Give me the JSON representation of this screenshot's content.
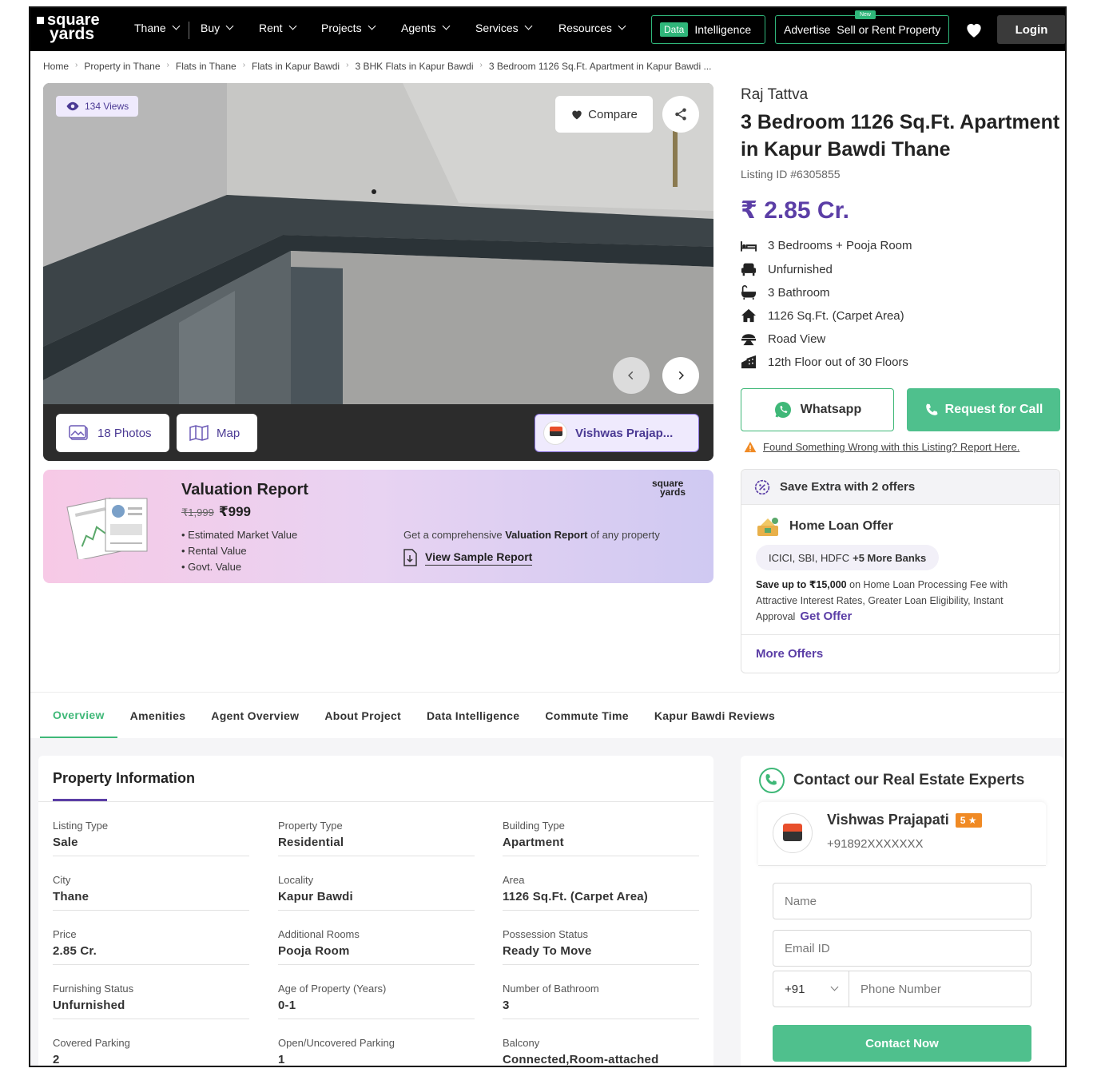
{
  "nav": {
    "logo_line1": "square",
    "logo_line2": "yards",
    "items": [
      "Thane",
      "Buy",
      "Rent",
      "Projects",
      "Agents",
      "Services",
      "Resources"
    ],
    "data_badge": "Data",
    "intelligence": "Intelligence",
    "advertise": "Advertise",
    "sell_rent": "Sell or Rent Property",
    "new_badge": "New",
    "login": "Login"
  },
  "breadcrumbs": [
    "Home",
    "Property in Thane",
    "Flats in Thane",
    "Flats in Kapur Bawdi",
    "3 BHK Flats in Kapur Bawdi",
    "3 Bedroom 1126 Sq.Ft. Apartment in Kapur Bawdi ..."
  ],
  "gallery": {
    "views": "134 Views",
    "compare": "Compare",
    "photos": "18 Photos",
    "map": "Map",
    "agent_chip": "Vishwas Prajap..."
  },
  "valuation": {
    "title": "Valuation Report",
    "old_price": "₹1,999",
    "new_price": "₹999",
    "points": [
      "Estimated Market Value",
      "Rental Value",
      "Govt. Value"
    ],
    "brand_line1": "square",
    "brand_line2": "yards",
    "desc_pre": "Get a comprehensive",
    "desc_bold": "Valuation Report",
    "desc_post": "of any property",
    "sample_link": "View Sample Report"
  },
  "listing": {
    "project": "Raj Tattva",
    "title": "3 Bedroom 1126 Sq.Ft. Apartment in Kapur Bawdi Thane",
    "listing_id": "Listing ID #6305855",
    "price": "₹ 2.85 Cr.",
    "features": [
      {
        "icon": "bed-icon",
        "text": "3 Bedrooms + Pooja Room"
      },
      {
        "icon": "sofa-icon",
        "text": "Unfurnished"
      },
      {
        "icon": "bathtub-icon",
        "text": "3 Bathroom"
      },
      {
        "icon": "home-icon",
        "text": "1126 Sq.Ft. (Carpet Area)"
      },
      {
        "icon": "road-view-icon",
        "text": "Road View"
      },
      {
        "icon": "building-floor-icon",
        "text": "12th Floor out of 30 Floors"
      }
    ],
    "whatsapp": "Whatsapp",
    "request_call": "Request for Call",
    "report": "Found Something Wrong with this Listing? Report Here."
  },
  "offers": {
    "header": "Save Extra with 2 offers",
    "offer_name": "Home Loan Offer",
    "banks": "ICICI, SBI, HDFC",
    "banks_more": "+5 More Banks",
    "desc_pre": "Save up to",
    "desc_amount": "₹15,000",
    "desc_post": "on Home Loan Processing Fee with Attractive Interest Rates, Greater Loan Eligibility, Instant Approval",
    "get_offer": "Get Offer",
    "more_offers": "More Offers"
  },
  "tabs": [
    "Overview",
    "Amenities",
    "Agent Overview",
    "About Project",
    "Data Intelligence",
    "Commute Time",
    "Kapur Bawdi Reviews"
  ],
  "property_info": {
    "title": "Property Information",
    "rows": [
      [
        {
          "label": "Listing Type",
          "value": "Sale"
        },
        {
          "label": "Property Type",
          "value": "Residential"
        },
        {
          "label": "Building Type",
          "value": "Apartment"
        }
      ],
      [
        {
          "label": "City",
          "value": "Thane"
        },
        {
          "label": "Locality",
          "value": "Kapur Bawdi"
        },
        {
          "label": "Area",
          "value": "1126 Sq.Ft. (Carpet Area)"
        }
      ],
      [
        {
          "label": "Price",
          "value": "2.85 Cr."
        },
        {
          "label": "Additional Rooms",
          "value": "Pooja Room"
        },
        {
          "label": "Possession Status",
          "value": "Ready To Move"
        }
      ],
      [
        {
          "label": "Furnishing Status",
          "value": "Unfurnished"
        },
        {
          "label": "Age of Property (Years)",
          "value": "0-1"
        },
        {
          "label": "Number of Bathroom",
          "value": "3"
        }
      ],
      [
        {
          "label": "Covered Parking",
          "value": "2"
        },
        {
          "label": "Open/Uncovered Parking",
          "value": "1"
        },
        {
          "label": "Balcony",
          "value": "Connected,Room-attached"
        }
      ]
    ]
  },
  "contact": {
    "title": "Contact our Real Estate Experts",
    "agent_name": "Vishwas Prajapati",
    "rating": "5 ★",
    "agent_phone": "+91892XXXXXXX",
    "name_placeholder": "Name",
    "email_placeholder": "Email ID",
    "country_code": "+91",
    "phone_placeholder": "Phone Number",
    "submit": "Contact Now"
  },
  "colors": {
    "brand_purple": "#5b3ea6",
    "brand_green": "#4fc08d",
    "nav_bg": "#000000"
  }
}
